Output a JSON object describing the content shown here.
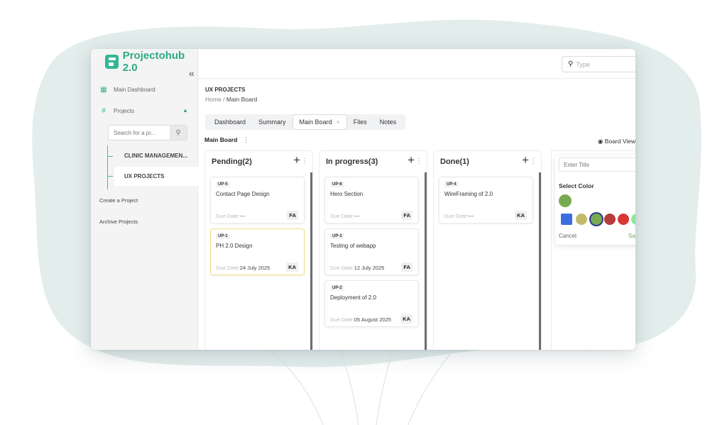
{
  "app": {
    "brand": "Projectohub 2.0",
    "collapse_glyph": "«"
  },
  "sidebar": {
    "main_dashboard": "Main Dashboard",
    "projects": "Projects",
    "search_placeholder": "Search for a pr...",
    "sub_items": [
      "CLINIC MANAGEMEN...",
      "UX PROJECTS"
    ],
    "active_sub_item": "UX PROJECTS",
    "create_project": "Create a Project",
    "archive_projects": "Archive Projects"
  },
  "topbar": {
    "search_placeholder": "Type"
  },
  "page": {
    "section_title": "UX PROJECTS",
    "breadcrumb_home": "Home",
    "breadcrumb_sep": "/",
    "breadcrumb_current": "Main Board",
    "tabs": [
      "Dashboard",
      "Summary",
      "Main Board",
      "Files",
      "Notes"
    ],
    "active_tab": "Main Board",
    "board_label": "Main Board",
    "board_view": "Board View"
  },
  "columns": [
    {
      "title": "Pending(2)",
      "cards": [
        {
          "id": "UP-5",
          "title": "Contact Page Design",
          "due_label": "Due Date:",
          "due": "---",
          "assignee": "FA",
          "highlight": false
        },
        {
          "id": "UP-1",
          "title": "PH 2.0 Design",
          "due_label": "Due Date:",
          "due": "24 July 2025",
          "assignee": "KA",
          "highlight": true
        }
      ]
    },
    {
      "title": "In progress(3)",
      "cards": [
        {
          "id": "UP-6",
          "title": "Hero Section",
          "due_label": "Due Date:",
          "due": "---",
          "assignee": "FA",
          "highlight": false
        },
        {
          "id": "UP-3",
          "title": "Testing of webapp",
          "due_label": "Due Date:",
          "due": "12 July 2025",
          "assignee": "FA",
          "highlight": false
        },
        {
          "id": "UP-2",
          "title": "Deployment of 2.0",
          "due_label": "Due Date:",
          "due": "05 August 2025",
          "assignee": "KA",
          "highlight": false
        }
      ]
    },
    {
      "title": "Done(1)",
      "cards": [
        {
          "id": "UP-4",
          "title": "WireFraming of 2.0",
          "due_label": "Due Date:",
          "due": "---",
          "assignee": "KA",
          "highlight": false
        }
      ]
    }
  ],
  "new_column": {
    "title_placeholder": "Enter Title",
    "select_color_label": "Select Color",
    "selected_color": "#78ab51",
    "swatches": [
      "#3b6fe0",
      "#c2bb6e",
      "#78ab51",
      "#b63b3b",
      "#d93636",
      "#8ee89c",
      "#2f6e2f"
    ],
    "cancel_label": "Cancel",
    "save_label": "Save"
  },
  "colors": {
    "brand": "#2fa987",
    "accent": "#34b594"
  }
}
